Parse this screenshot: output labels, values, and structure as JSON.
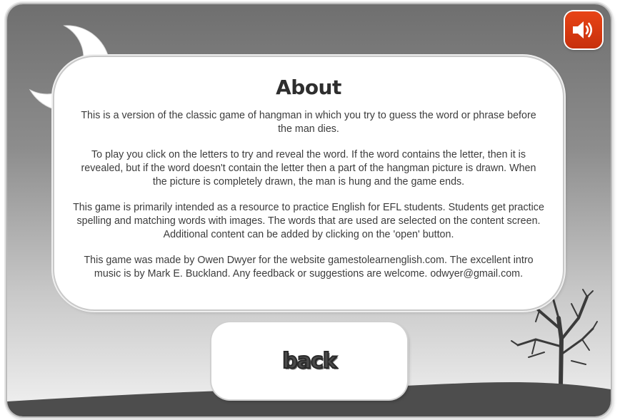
{
  "about": {
    "title": "About",
    "paragraphs": [
      "This is a version of the classic game of hangman in which you try to guess the word or phrase before the man dies.",
      "To play you click on the letters to try and reveal the word.  If the word contains the letter, then it is revealed, but if the word doesn't contain the letter then a part of the hangman picture is drawn. When the picture is completely drawn, the man is hung and the game ends.",
      "This game is primarily intended as a resource to practice English for EFL students.  Students get practice spelling and matching words with images.  The words that are used are selected on the content screen.  Additional content can be added by clicking on the 'open' button.",
      "This game was made by Owen Dwyer for the website gamestolearnenglish.com.  The excellent intro music is by Mark E. Buckland.  Any feedback or suggestions are welcome.  odwyer@gmail.com."
    ]
  },
  "back_button": {
    "label": "back"
  },
  "sound_button": {
    "icon": "speaker-volume-icon",
    "color": "#d9390f"
  },
  "scene": {
    "moon_icon": "crescent-moon-icon",
    "tree_icon": "bare-tree-icon",
    "hill_color": "#4d4d4d"
  }
}
